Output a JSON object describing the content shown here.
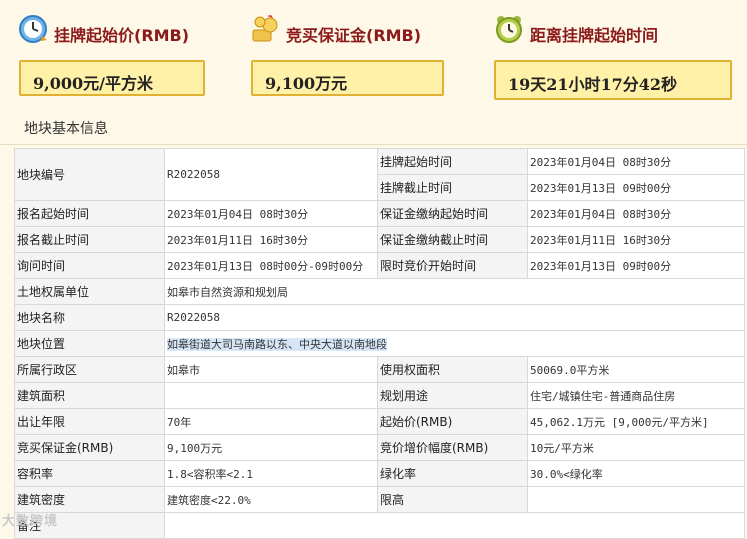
{
  "summary": {
    "start_price": {
      "label": "挂牌起始价(RMB)",
      "value": "9,000元/平方米",
      "icon": "clock-icon"
    },
    "deposit": {
      "label": "竞买保证金(RMB)",
      "value": "9,100万元",
      "icon": "money-icon"
    },
    "countdown": {
      "label": "距离挂牌起始时间",
      "value": "19天21小时17分42秒",
      "icon": "alarm-clock-icon"
    }
  },
  "section_title": "地块基本信息",
  "table": {
    "r1": {
      "l1": "地块编号",
      "v1": "R2022058",
      "l2": "挂牌起始时间",
      "v2": "2023年01月04日 08时30分",
      "l3": "挂牌截止时间",
      "v3": "2023年01月13日 09时00分"
    },
    "r2": {
      "l1": "报名起始时间",
      "v1": "2023年01月04日 08时30分",
      "l2": "保证金缴纳起始时间",
      "v2": "2023年01月04日 08时30分"
    },
    "r3": {
      "l1": "报名截止时间",
      "v1": "2023年01月11日 16时30分",
      "l2": "保证金缴纳截止时间",
      "v2": "2023年01月11日 16时30分"
    },
    "r4": {
      "l1": "询问时间",
      "v1": "2023年01月13日 08时00分-09时00分",
      "l2": "限时竞价开始时间",
      "v2": "2023年01月13日 09时00分"
    },
    "r5": {
      "l1": "土地权属单位",
      "v1": "如皋市自然资源和规划局"
    },
    "r6": {
      "l1": "地块名称",
      "v1": "R2022058"
    },
    "r7": {
      "l1": "地块位置",
      "v1": "如皋街道大司马南路以东、中央大道以南地段"
    },
    "r8": {
      "l1": "所属行政区",
      "v1": "如皋市",
      "l2": "使用权面积",
      "v2": "50069.0平方米"
    },
    "r9": {
      "l1": "建筑面积",
      "v1": "",
      "l2": "规划用途",
      "v2": "住宅/城镇住宅-普通商品住房"
    },
    "r10": {
      "l1": "出让年限",
      "v1": "70年",
      "l2": "起始价(RMB)",
      "v2": "45,062.1万元 [9,000元/平方米]"
    },
    "r11": {
      "l1": "竞买保证金(RMB)",
      "v1": "9,100万元",
      "l2": "竞价增价幅度(RMB)",
      "v2": "10元/平方米"
    },
    "r12": {
      "l1": "容积率",
      "v1": "1.8<容积率<2.1",
      "l2": "绿化率",
      "v2": "30.0%<绿化率"
    },
    "r13": {
      "l1": "建筑密度",
      "v1": "建筑密度<22.0%",
      "l2": "限高",
      "v2": ""
    },
    "r14": {
      "l1": "备注",
      "v1": ""
    }
  },
  "watermark": "大数跨境"
}
